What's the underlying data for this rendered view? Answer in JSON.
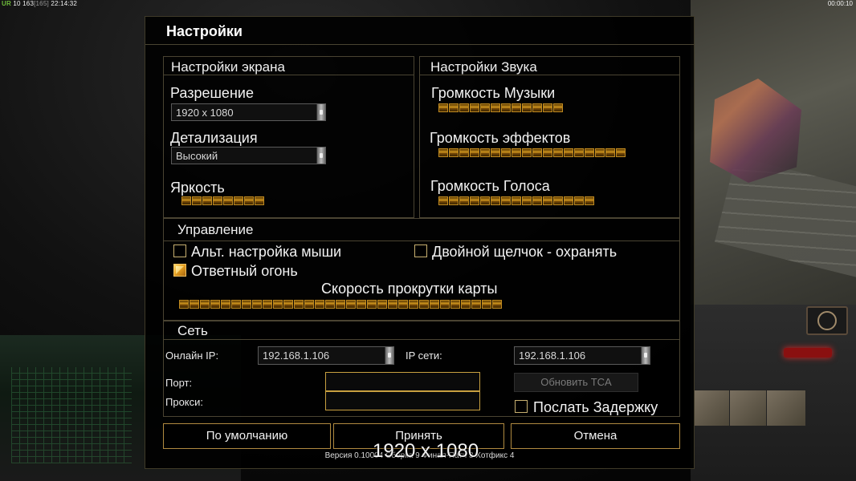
{
  "status": {
    "tag": "UR",
    "count": "10",
    "value": "163",
    "max": "[165]",
    "clock": "22:14:32",
    "timer": "00:00:10"
  },
  "dialog": {
    "title": "Настройки",
    "screen": {
      "header": "Настройки экрана",
      "resolution_label": "Разрешение",
      "resolution_value": "1920 x 1080",
      "detail_label": "Детализация",
      "detail_value": "Высокий",
      "brightness_label": "Яркость",
      "brightness_level": "8/8"
    },
    "sound": {
      "header": "Настройки Звука",
      "music_label": "Громкость Музыки",
      "music_level": "12/12",
      "effects_label": "Громкость эффектов",
      "effects_level": "18/18",
      "voice_label": "Громкость Голоса",
      "voice_level": "15/15"
    },
    "controls": {
      "header": "Управление",
      "alt_mouse_label": "Альт. настройка мыши",
      "alt_mouse_checked": false,
      "double_click_label": "Двойной щелчок - охранять",
      "double_click_checked": false,
      "retaliation_label": "Ответный огонь",
      "retaliation_checked": true,
      "scroll_speed_label": "Скорость прокрутки карты",
      "scroll_speed_level": "31/31"
    },
    "network": {
      "header": "Сеть",
      "online_ip_label": "Онлайн IP:",
      "online_ip_value": "192.168.1.106",
      "lan_ip_label": "IP сети:",
      "lan_ip_value": "192.168.1.106",
      "port_label": "Порт:",
      "port_value": "",
      "proxy_label": "Прокси:",
      "proxy_value": "",
      "update_tca_label": "Обновить TCA",
      "send_delay_label": "Послать Задержку",
      "send_delay_checked": false
    },
    "buttons": {
      "default_label": "По умолчанию",
      "accept_label": "Принять",
      "cancel_label": "Отмена"
    },
    "version": "Версия 0.10004 Сборка 9 Финал-Патч 3 Хотфикс 4"
  },
  "overlay": {
    "resolution_text": "1920 x 1080"
  },
  "colors": {
    "accent_gold": "#c08a20",
    "panel_border": "#4a4432",
    "button_border": "#b08a40"
  }
}
